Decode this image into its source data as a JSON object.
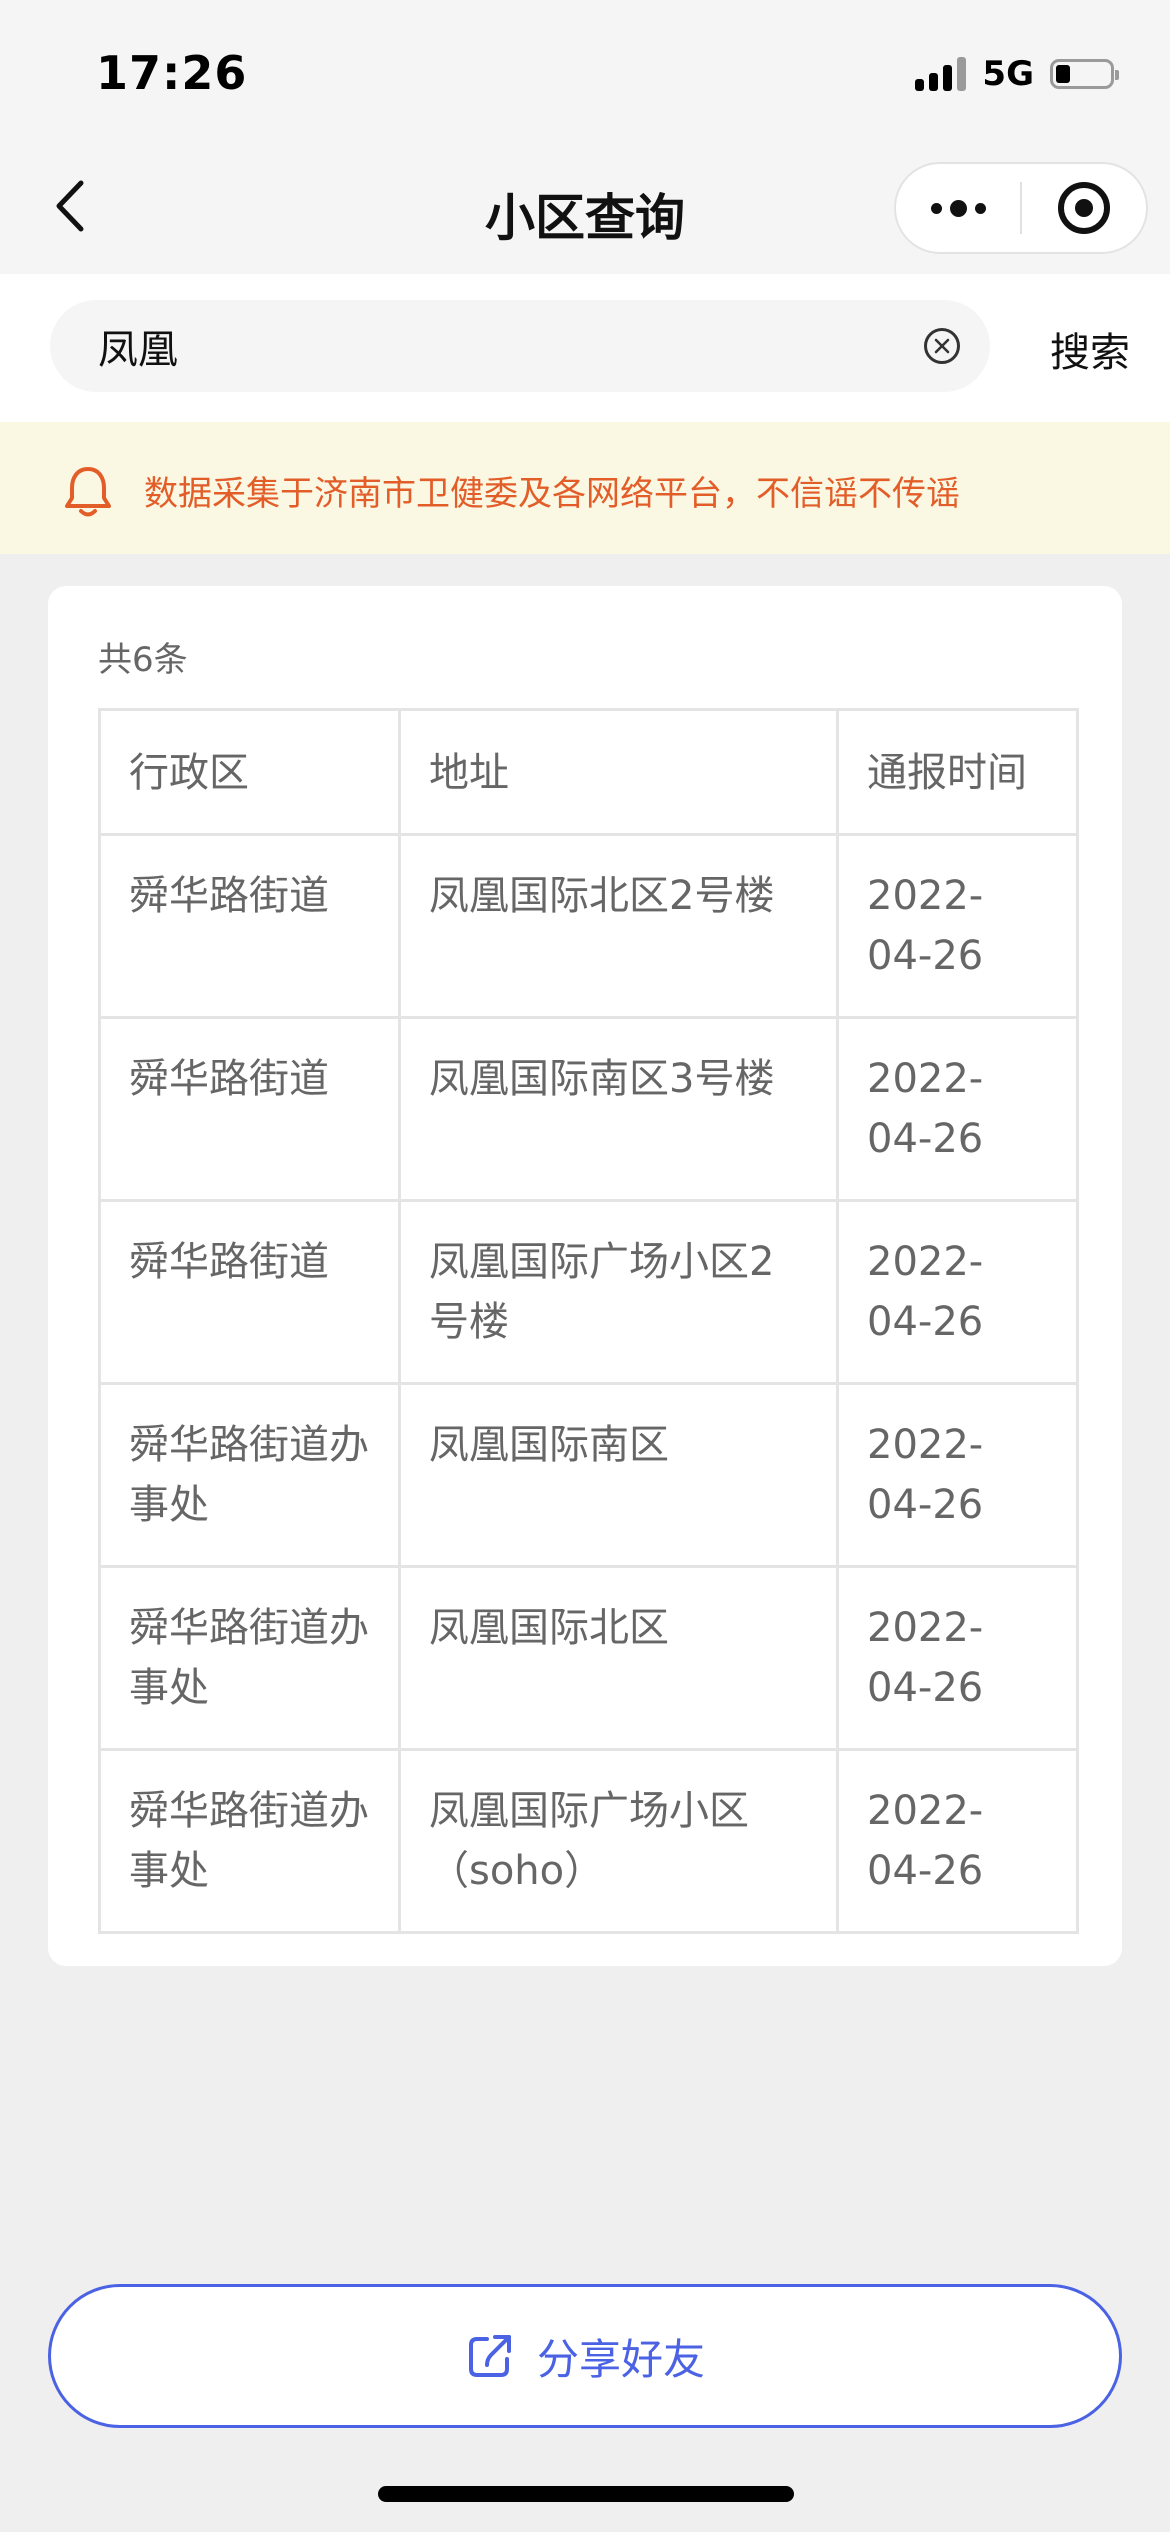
{
  "status_bar": {
    "time": "17:26",
    "network": "5G"
  },
  "nav": {
    "title": "小区查询"
  },
  "search": {
    "query": "凤凰",
    "button_label": "搜索"
  },
  "notice": {
    "text": "数据采集于济南市卫健委及各网络平台，不信谣不传谣",
    "color": "#e35d29"
  },
  "results": {
    "count_label": "共6条",
    "headers": [
      "行政区",
      "地址",
      "通报时间"
    ],
    "rows": [
      {
        "district": "舜华路街道",
        "address": "凤凰国际北区2号楼",
        "date_year": "2022-",
        "date_md": "04-26"
      },
      {
        "district": "舜华路街道",
        "address": "凤凰国际南区3号楼",
        "date_year": "2022-",
        "date_md": "04-26"
      },
      {
        "district": "舜华路街道",
        "address": "凤凰国际广场小区2号楼",
        "date_year": "2022-",
        "date_md": "04-26"
      },
      {
        "district": "舜华路街道办事处",
        "address": "凤凰国际南区",
        "date_year": "2022-",
        "date_md": "04-26"
      },
      {
        "district": "舜华路街道办事处",
        "address": "凤凰国际北区",
        "date_year": "2022-",
        "date_md": "04-26"
      },
      {
        "district": "舜华路街道办事处",
        "address": "凤凰国际广场小区（soho）",
        "date_year": "2022-",
        "date_md": "04-26"
      }
    ]
  },
  "share": {
    "label": "分享好友",
    "accent_color": "#4a62e3"
  },
  "icons": {
    "back": "chevron-left-icon",
    "more": "more-dots-icon",
    "target": "target-icon",
    "clear": "clear-circle-icon",
    "notice": "bell-icon",
    "share": "share-icon"
  }
}
